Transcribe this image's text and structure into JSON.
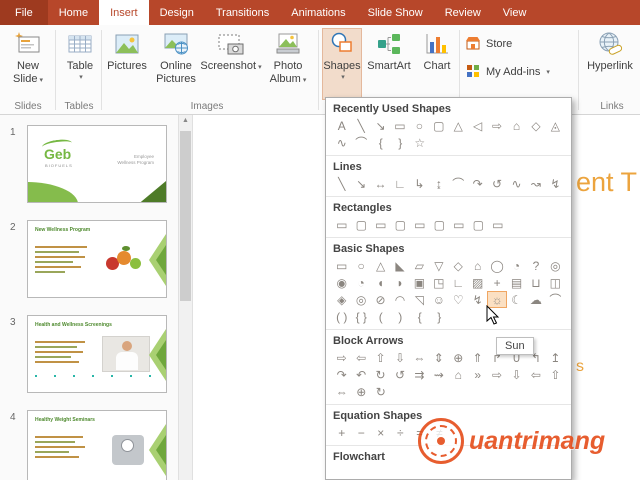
{
  "tab_bar": {
    "active_tab": "Insert",
    "tabs": [
      {
        "label": "File"
      },
      {
        "label": "Home"
      },
      {
        "label": "Insert"
      },
      {
        "label": "Design"
      },
      {
        "label": "Transitions"
      },
      {
        "label": "Animations"
      },
      {
        "label": "Slide Show"
      },
      {
        "label": "Review"
      },
      {
        "label": "View"
      }
    ]
  },
  "icons": {
    "dropdown_arrow": "▾",
    "scroll_up_arrow": "▲"
  },
  "ribbon": {
    "new_slide": {
      "line1": "New",
      "line2": "Slide"
    },
    "table": {
      "label": "Table"
    },
    "pictures": {
      "label": "Pictures"
    },
    "online_pictures": {
      "line1": "Online",
      "line2": "Pictures"
    },
    "screenshot": {
      "label": "Screenshot"
    },
    "photo_album": {
      "line1": "Photo",
      "line2": "Album"
    },
    "shapes": {
      "label": "Shapes"
    },
    "smartart": {
      "label": "SmartArt"
    },
    "chart": {
      "label": "Chart"
    },
    "store": {
      "label": "Store"
    },
    "my_addins": {
      "label": "My Add-ins"
    },
    "hyperlink": {
      "label": "Hyperlink"
    },
    "group_labels": {
      "slides": "Slides",
      "tables": "Tables",
      "images": "Images",
      "links": "Links"
    }
  },
  "slide_panel": {
    "slides": [
      {
        "number": "1",
        "logo_text": "Geb",
        "logo_sub": "BIOFUELS",
        "side_text_1": "Employee",
        "side_text_2": "Wellness Program"
      },
      {
        "number": "2",
        "title": "New Wellness Program"
      },
      {
        "number": "3",
        "title": "Health and Wellness Screenings"
      },
      {
        "number": "4",
        "title": "Healthy Weight Seminars"
      }
    ]
  },
  "canvas": {
    "title_fragment": "ent T",
    "body_fragment": "s"
  },
  "watermark": {
    "text": "uantrimang"
  },
  "shapes_menu": {
    "sections": [
      {
        "title": "Recently Used Shapes",
        "rows": [
          [
            "A",
            "╲",
            "↘",
            "▭",
            "○",
            "▢",
            "△",
            "◁",
            "⇨",
            "⌂",
            "◇",
            "◬"
          ],
          [
            "∿",
            "⌒",
            "{",
            "}",
            "☆"
          ]
        ]
      },
      {
        "title": "Lines",
        "rows": [
          [
            "╲",
            "↘",
            "↔",
            "∟",
            "↳",
            "↨",
            "⌒",
            "↷",
            "↺",
            "∿",
            "↝",
            "↯"
          ]
        ]
      },
      {
        "title": "Rectangles",
        "rows": [
          [
            "▭",
            "▢",
            "▭",
            "▢",
            "▭",
            "▢",
            "▭",
            "▢",
            "▭"
          ]
        ]
      },
      {
        "title": "Basic Shapes",
        "rows": [
          [
            "▭",
            "○",
            "△",
            "◣",
            "▱",
            "▽",
            "◇",
            "⌂",
            "◯",
            "◔",
            "?",
            "◎"
          ],
          [
            "◉",
            "◔",
            "◖",
            "◗",
            "▣",
            "◳",
            "∟",
            "▨",
            "+",
            "▤",
            "⊔",
            "◫"
          ],
          [
            "◈",
            "◎",
            "⊘",
            "◠",
            "◹",
            "☺",
            "♡",
            "↯",
            "☼",
            "☾",
            "☁",
            "⌒"
          ],
          [
            "( )",
            "{ }",
            "(",
            ")",
            "{",
            "}"
          ]
        ]
      },
      {
        "title": "Block Arrows",
        "rows": [
          [
            "⇨",
            "⇦",
            "⇧",
            "⇩",
            "⇔",
            "⇕",
            "⊕",
            "⇑",
            "↱",
            "∪",
            "↰",
            "↥"
          ],
          [
            "↷",
            "↶",
            "↻",
            "↺",
            "⇉",
            "⇝",
            "⌂",
            "»",
            "⇨",
            "⇩",
            "⇦",
            "⇧"
          ],
          [
            "⇔",
            "⊕",
            "↻"
          ]
        ]
      },
      {
        "title": "Equation Shapes",
        "rows": [
          [
            "+",
            "−",
            "×",
            "÷",
            "=",
            "≠"
          ]
        ]
      },
      {
        "title": "Flowchart",
        "rows": []
      }
    ],
    "hover": {
      "section_index": 3,
      "row_index": 2,
      "cell_index": 8,
      "tooltip": "Sun"
    }
  }
}
